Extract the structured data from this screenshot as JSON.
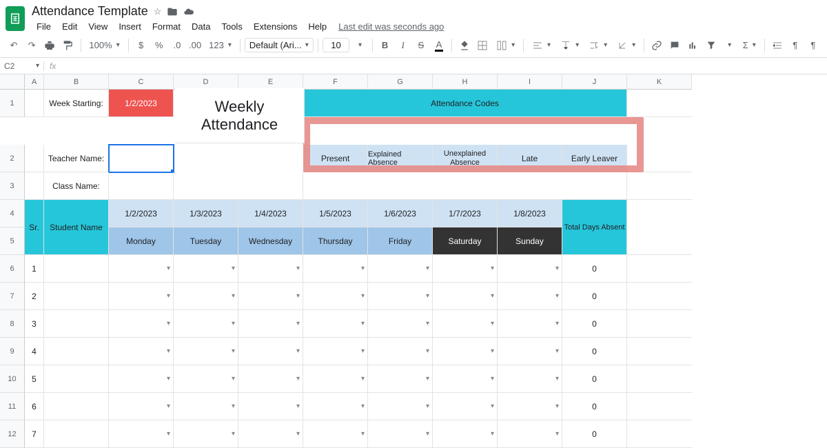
{
  "doc": {
    "title": "Attendance Template"
  },
  "menu": {
    "file": "File",
    "edit": "Edit",
    "view": "View",
    "insert": "Insert",
    "format": "Format",
    "data": "Data",
    "tools": "Tools",
    "extensions": "Extensions",
    "help": "Help",
    "status": "Last edit was seconds ago"
  },
  "toolbar": {
    "zoom": "100%",
    "font": "Default (Ari...",
    "size": "10",
    "decimal": ".0",
    "decimal2": ".00",
    "num": "123",
    "currency": "$",
    "percent": "%"
  },
  "namebox": "C2",
  "sheet": {
    "week_starting_label": "Week Starting:",
    "week_starting_value": "1/2/2023",
    "teacher_label": "Teacher Name:",
    "class_label": "Class Name:",
    "big_title": "Weekly Attendance",
    "codes_title": "Attendance Codes",
    "codes": [
      "Present",
      "Explained Absence",
      "Unexplained Absence",
      "Late",
      "Early Leaver"
    ],
    "sr": "Sr.",
    "student_name": "Student Name",
    "dates": [
      "1/2/2023",
      "1/3/2023",
      "1/4/2023",
      "1/5/2023",
      "1/6/2023",
      "1/7/2023",
      "1/8/2023"
    ],
    "days": [
      "Monday",
      "Tuesday",
      "Wednesday",
      "Thursday",
      "Friday",
      "Saturday",
      "Sunday"
    ],
    "total_label": "Total Days Absent",
    "row_nums": [
      "1",
      "2",
      "3",
      "4",
      "5",
      "6",
      "7"
    ],
    "zero": "0"
  },
  "row_headers": [
    "1",
    "2",
    "3",
    "4",
    "5",
    "6",
    "7",
    "8",
    "9",
    "10",
    "11",
    "12"
  ],
  "col_headers": [
    "A",
    "B",
    "C",
    "D",
    "E",
    "F",
    "G",
    "H",
    "I",
    "J",
    "K"
  ]
}
